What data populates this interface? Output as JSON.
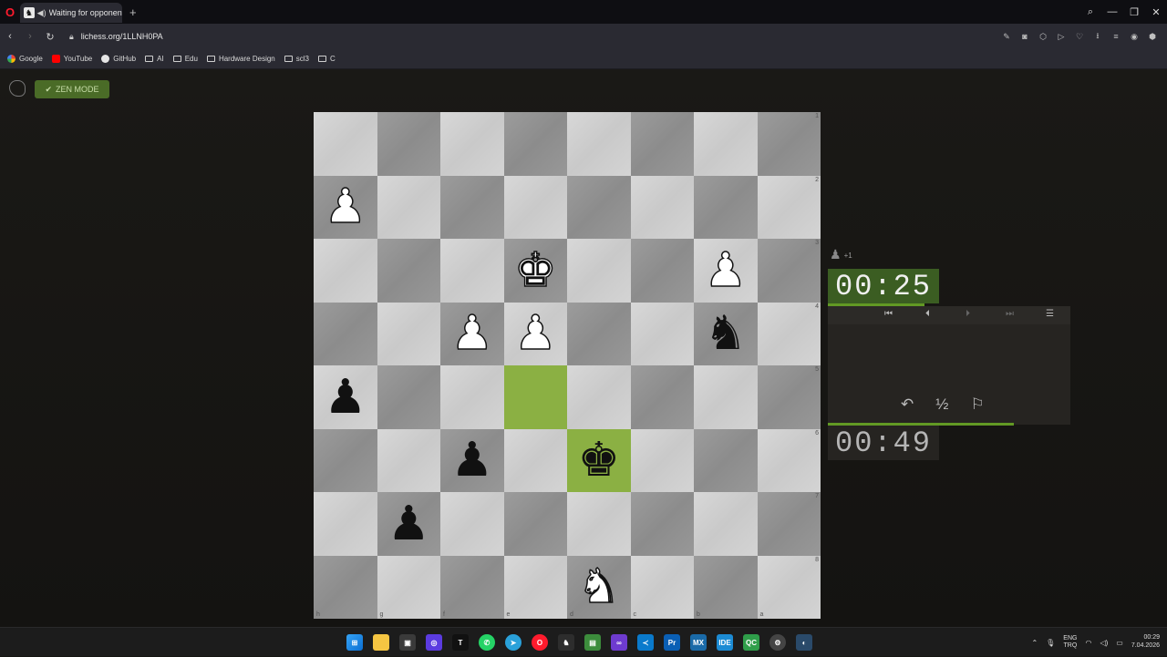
{
  "browser": {
    "tab_title": "Waiting for opponent",
    "url": "lichess.org/1LLNH0PA",
    "bookmarks": [
      "Google",
      "YouTube",
      "GitHub",
      "AI",
      "Edu",
      "Hardware Design",
      "scl3",
      "C"
    ]
  },
  "lichess": {
    "zen_mode_label": "ZEN MODE",
    "material_diff": "+1",
    "clock_top": "00:25",
    "clock_bottom": "00:49",
    "rank_labels": [
      "1",
      "2",
      "3",
      "4",
      "5",
      "6",
      "7",
      "8"
    ],
    "file_labels": [
      "h",
      "g",
      "f",
      "e",
      "d",
      "c",
      "b",
      "a"
    ],
    "board": [
      [
        "",
        "",
        "",
        "",
        "",
        "",
        "",
        ""
      ],
      [
        "wP",
        "",
        "",
        "",
        "",
        "",
        "",
        ""
      ],
      [
        "",
        "",
        "",
        "wK",
        "",
        "",
        "wP",
        ""
      ],
      [
        "",
        "",
        "wP",
        "wP",
        "",
        "",
        "bN",
        ""
      ],
      [
        "bP",
        "",
        "",
        "",
        "",
        "",
        "",
        ""
      ],
      [
        "",
        "",
        "bP",
        "",
        "bK",
        "",
        "",
        ""
      ],
      [
        "",
        "bP",
        "",
        "",
        "",
        "",
        "",
        ""
      ],
      [
        "",
        "",
        "",
        "",
        "wN",
        "",
        "",
        ""
      ]
    ],
    "highlighted_squares": [
      [
        4,
        3
      ],
      [
        5,
        4
      ]
    ],
    "draw_symbol": "½"
  },
  "taskbar": {
    "lang_top": "ENG",
    "lang_bottom": "TRQ",
    "time": "00:29",
    "date": "7.04.2026"
  }
}
